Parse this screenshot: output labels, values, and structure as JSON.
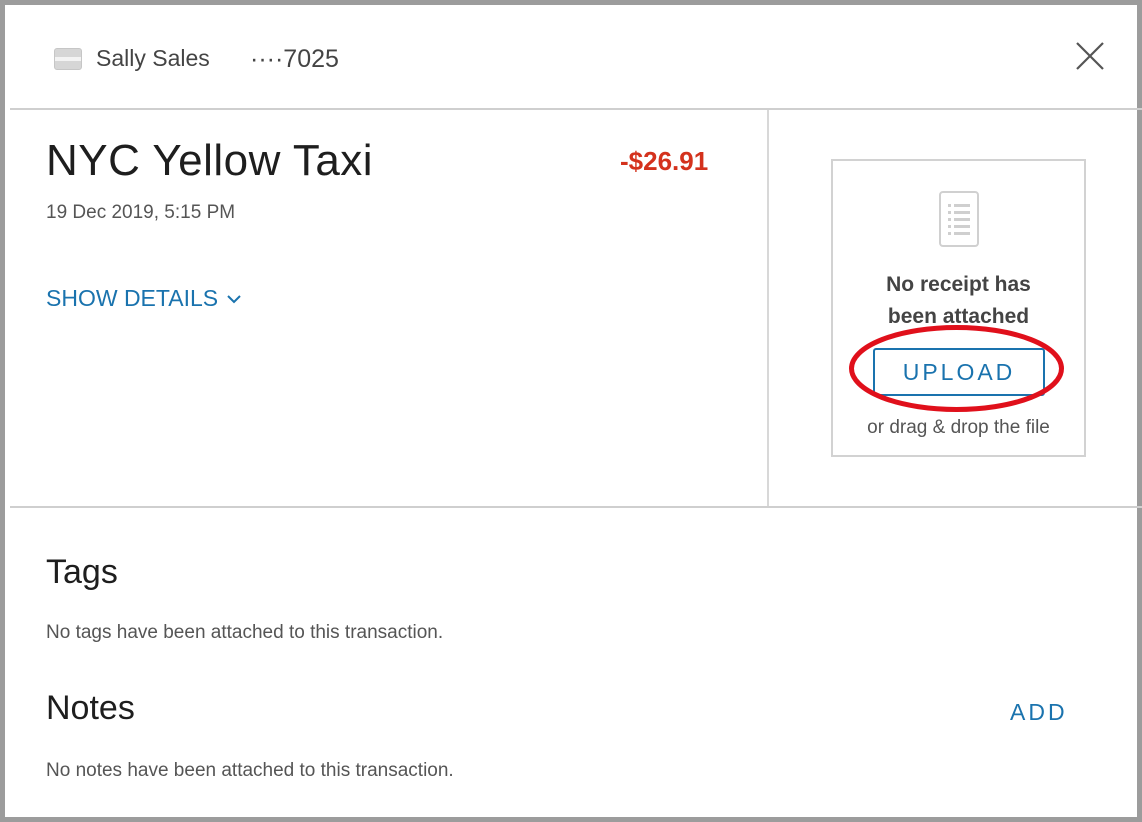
{
  "header": {
    "account_name": "Sally Sales",
    "account_number": "····7025",
    "card_icon": "credit-card-icon",
    "close_icon": "close-icon"
  },
  "transaction": {
    "merchant": "NYC Yellow Taxi",
    "amount": "-$26.91",
    "datetime": "19 Dec 2019, 5:15 PM",
    "show_details_label": "SHOW DETAILS",
    "amount_color": "#d4321d"
  },
  "receipt": {
    "icon": "receipt-icon",
    "message_line1": "No receipt has",
    "message_line2": "been attached",
    "upload_label": "UPLOAD",
    "drag_text": "or drag & drop the file"
  },
  "tags": {
    "title": "Tags",
    "empty_text": "No tags have been attached to this transaction."
  },
  "notes": {
    "title": "Notes",
    "add_label": "ADD",
    "empty_text": "No notes have been attached to this transaction."
  },
  "colors": {
    "accent": "#1a73ae",
    "highlight": "#e0101b"
  }
}
